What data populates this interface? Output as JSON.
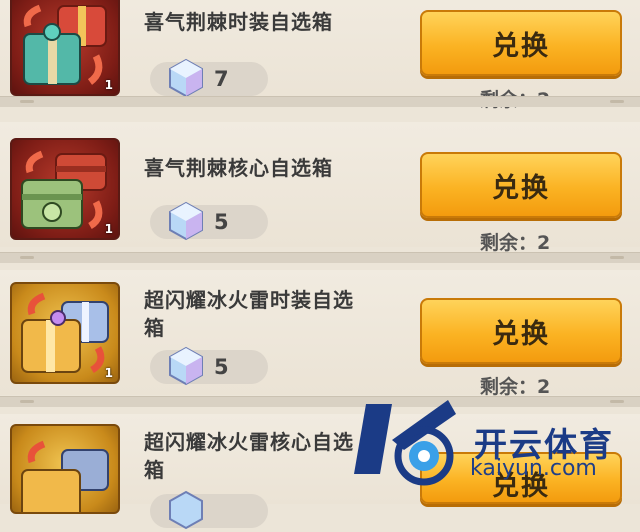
{
  "items": [
    {
      "name_line1": "喜气荆棘时装自选箱",
      "name_line2": "",
      "cost": "7",
      "button": "兑换",
      "remain_label": "剩余：",
      "remain_value": "2",
      "qty": "1"
    },
    {
      "name_line1": "喜气荆棘核心自选箱",
      "name_line2": "",
      "cost": "5",
      "button": "兑换",
      "remain_label": "剩余：",
      "remain_value": "2",
      "qty": "1"
    },
    {
      "name_line1": "超闪耀冰火雷时装自选",
      "name_line2": "箱",
      "cost": "5",
      "button": "兑换",
      "remain_label": "剩余：",
      "remain_value": "2",
      "qty": "1"
    },
    {
      "name_line1": "超闪耀冰火雷核心自选",
      "name_line2": "箱",
      "cost": "",
      "button": "兑换",
      "remain_label": "",
      "remain_value": "",
      "qty": ""
    }
  ],
  "watermark": {
    "title": "开云体育",
    "url": "kaiyun.com"
  },
  "colors": {
    "button": "#fbb323",
    "background": "#ece5d8",
    "watermark": "#1b3b86"
  },
  "icons": {
    "currency": "crystal-cube-icon",
    "item": "gift-box-icon"
  }
}
